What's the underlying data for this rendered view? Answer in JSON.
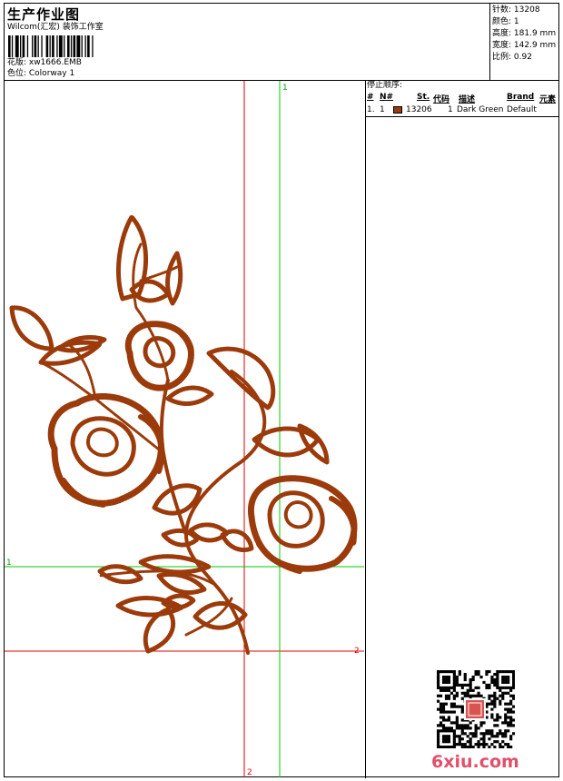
{
  "header": {
    "title": "生产作业图",
    "company": "Wilcom(汇宏) 装饰工作室",
    "design_line": "花版: xw1666.EMB",
    "colorway_line": "色位: Colorway 1"
  },
  "stats": [
    {
      "label": "针数:",
      "value": "13208"
    },
    {
      "label": "颜色:",
      "value": "1"
    },
    {
      "label": "高度:",
      "value": "181.9 mm"
    },
    {
      "label": "宽度:",
      "value": "142.9 mm"
    },
    {
      "label": "比例:",
      "value": "0.92"
    }
  ],
  "stop_sequence": {
    "title": "停止顺序:",
    "headers": {
      "num": "#",
      "n": "N#",
      "st": "St.",
      "code": "代码",
      "desc": "描述",
      "brand": "Brand",
      "element": "元素"
    },
    "rows": [
      {
        "num": "1.",
        "n": "1",
        "color": "#9b3a0a",
        "st": "13206",
        "code": "1",
        "desc": "Dark Green",
        "brand": "Default"
      }
    ]
  },
  "guides": {
    "v1_label": "1",
    "h1_label": "1",
    "h2_label": "2",
    "v2_label": "2"
  },
  "thread_color": "#9b3a0a",
  "watermark": "6xiu.com"
}
